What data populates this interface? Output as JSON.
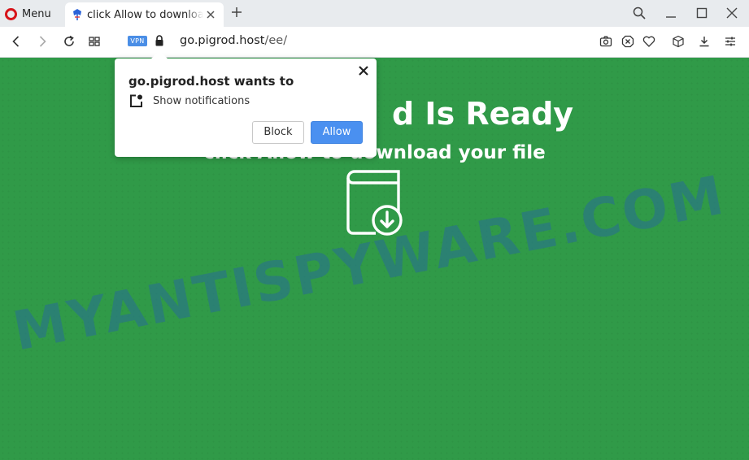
{
  "browser": {
    "menu_label": "Menu",
    "tab": {
      "title": "click Allow to download"
    },
    "vpn_label": "VPN",
    "url_host": "go.pigrod.host",
    "url_path": "/ee/"
  },
  "page": {
    "heading": "d Is Ready",
    "subheading": "click Allow to download your file",
    "watermark": "MYANTISPYWARE.COM",
    "background_color": "#309a48"
  },
  "popup": {
    "title": "go.pigrod.host wants to",
    "permission": "Show notifications",
    "block_label": "Block",
    "allow_label": "Allow",
    "allow_color": "#4a90f0"
  }
}
